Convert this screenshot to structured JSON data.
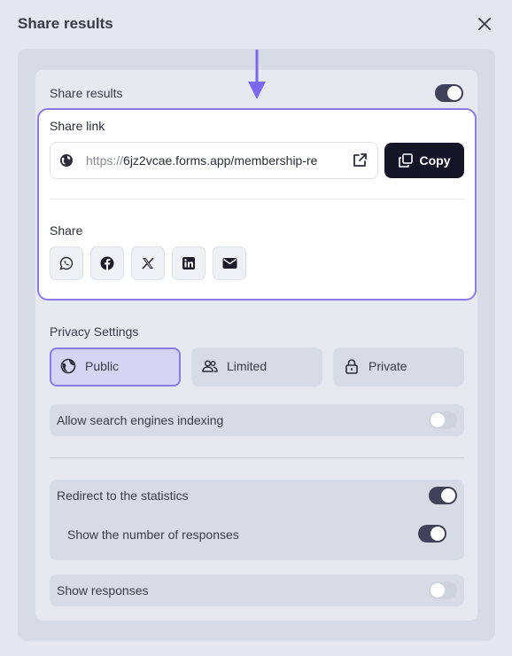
{
  "header": {
    "title": "Share results"
  },
  "share_results": {
    "label": "Share results",
    "enabled": true
  },
  "share_link": {
    "label": "Share link",
    "url_prefix": "https://",
    "url_rest": "6jz2vcae.forms.app/membership-re",
    "copy_label": "Copy"
  },
  "share": {
    "label": "Share",
    "buttons": [
      "whatsapp-icon",
      "facebook-icon",
      "x-icon",
      "linkedin-icon",
      "email-icon"
    ]
  },
  "privacy": {
    "label": "Privacy Settings",
    "options": [
      {
        "label": "Public",
        "icon": "globe-icon",
        "selected": true
      },
      {
        "label": "Limited",
        "icon": "users-icon",
        "selected": false
      },
      {
        "label": "Private",
        "icon": "lock-icon",
        "selected": false
      }
    ]
  },
  "settings": {
    "search_indexing": {
      "label": "Allow search engines indexing",
      "enabled": false
    },
    "redirect_statistics": {
      "label": "Redirect to the statistics",
      "enabled": true
    },
    "show_response_count": {
      "label": "Show the number of responses",
      "enabled": true
    },
    "show_responses": {
      "label": "Show responses",
      "enabled": false
    }
  },
  "colors": {
    "accent": "#8b7bea",
    "copy_button": "#141628",
    "toggle_on": "#3f4258",
    "toggle_off": "#cfd3dd"
  }
}
